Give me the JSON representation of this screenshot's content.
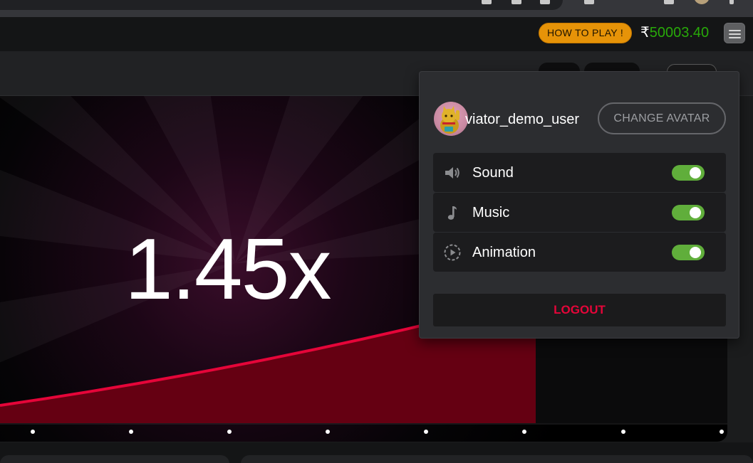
{
  "header": {
    "how_to_play_label": "HOW TO PLAY !",
    "balance_currency": "₹",
    "balance_amount": "50003.40"
  },
  "game": {
    "multiplier": "1.45x"
  },
  "settings_menu": {
    "username": "viator_demo_user",
    "change_avatar_label": "CHANGE AVATAR",
    "items": [
      {
        "label": "Sound",
        "icon": "speaker-icon",
        "enabled": true
      },
      {
        "label": "Music",
        "icon": "music-note-icon",
        "enabled": true
      },
      {
        "label": "Animation",
        "icon": "play-circle-icon",
        "enabled": true
      }
    ],
    "logout_label": "LOGOUT"
  },
  "colors": {
    "balance_green": "#28a909",
    "how_to_play_orange": "#e69308",
    "toggle_on": "#60ae3b",
    "logout_red": "#e50539",
    "accent_pink": "#e50539",
    "panel_bg": "#2c2d30"
  }
}
